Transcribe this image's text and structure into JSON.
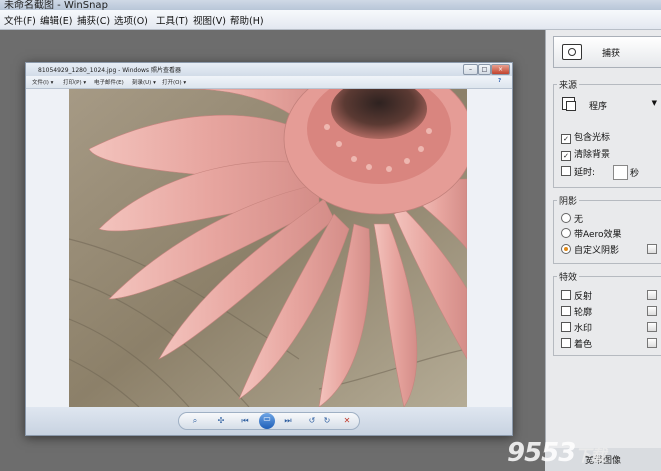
{
  "app": {
    "title": "未命名截图 - WinSnap"
  },
  "menu": {
    "items": [
      {
        "label": "文件(F)"
      },
      {
        "label": "编辑(E)"
      },
      {
        "label": "捕获(C)"
      },
      {
        "label": "选项(O)"
      },
      {
        "label": "工具(T)"
      },
      {
        "label": "视图(V)"
      },
      {
        "label": "帮助(H)"
      }
    ]
  },
  "viewer": {
    "title": "81054929_1280_1024.jpg - Windows 照片查看器",
    "window_buttons": [
      "–",
      "□",
      "×"
    ],
    "toolbar": [
      {
        "label": "文件(I) ▾"
      },
      {
        "label": "打印(P) ▾"
      },
      {
        "label": "电子邮件(E)"
      },
      {
        "label": "刻录(U) ▾"
      },
      {
        "label": "打开(O) ▾"
      }
    ],
    "help": "?"
  },
  "right_panel": {
    "capture_label": "捕获",
    "source": {
      "title": "来源",
      "selected": "程序",
      "options": [
        {
          "label": "包含光标",
          "checked": true
        },
        {
          "label": "清除背景",
          "checked": true
        },
        {
          "label": "延时:",
          "checked": false
        }
      ],
      "delay_unit": "秒"
    },
    "shadow": {
      "title": "阴影",
      "options": [
        {
          "label": "无",
          "selected": false
        },
        {
          "label": "带Aero效果",
          "selected": false
        },
        {
          "label": "自定义阴影",
          "selected": true
        }
      ]
    },
    "effects": {
      "title": "特效",
      "options": [
        {
          "label": "反射",
          "checked": false
        },
        {
          "label": "轮廓",
          "checked": false
        },
        {
          "label": "水印",
          "checked": false
        },
        {
          "label": "着色",
          "checked": false
        }
      ]
    },
    "bottom_label": "宽带图像"
  },
  "watermark": {
    "main": "9553",
    "sub": "下载"
  },
  "colors": {
    "accent_radio": "#e08a1a",
    "workspace": "#6d6d6d",
    "petal": "#e7a59f"
  }
}
